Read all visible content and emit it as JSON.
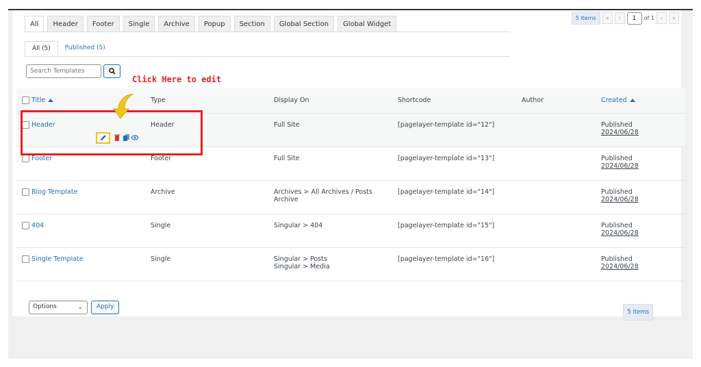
{
  "type_tabs": [
    "All",
    "Header",
    "Footer",
    "Single",
    "Archive",
    "Popup",
    "Section",
    "Global Section",
    "Global Widget"
  ],
  "pagination": {
    "count": "5 items",
    "first": "«",
    "prev": "‹",
    "current": "1",
    "of": "of 1",
    "next": "›",
    "last": "»"
  },
  "status_tabs": [
    "All (5)",
    "Published (5)"
  ],
  "search": {
    "placeholder": "Search Templates"
  },
  "hint": "Click Here to edit",
  "columns": {
    "title": "Title",
    "type": "Type",
    "display_on": "Display On",
    "shortcode": "Shortcode",
    "author": "Author",
    "created": "Created"
  },
  "rows": [
    {
      "title": "Header",
      "type": "Header",
      "display_on": "Full Site",
      "display_on_2": "",
      "shortcode": "[pagelayer-template id=\"12\"]",
      "status": "Published",
      "date": "2024/06/28"
    },
    {
      "title": "Footer",
      "type": "Footer",
      "display_on": "Full Site",
      "display_on_2": "",
      "shortcode": "[pagelayer-template id=\"13\"]",
      "status": "Published",
      "date": "2024/06/28"
    },
    {
      "title": "Blog Template",
      "type": "Archive",
      "display_on": "Archives > All Archives / Posts Archive",
      "display_on_2": "",
      "shortcode": "[pagelayer-template id=\"14\"]",
      "status": "Published",
      "date": "2024/06/28"
    },
    {
      "title": "404",
      "type": "Single",
      "display_on": "Singular > 404",
      "display_on_2": "",
      "shortcode": "[pagelayer-template id=\"15\"]",
      "status": "Published",
      "date": "2024/06/28"
    },
    {
      "title": "Single Template",
      "type": "Single",
      "display_on": "Singular > Posts",
      "display_on_2": "Singular > Media",
      "shortcode": "[pagelayer-template id=\"16\"]",
      "status": "Published",
      "date": "2024/06/28"
    }
  ],
  "bulk": {
    "selected": "Options",
    "apply": "Apply"
  },
  "footer_count": "5 items",
  "colors": {
    "link": "#2271b1",
    "highlight": "#e62020",
    "arrow": "#f0c419"
  }
}
